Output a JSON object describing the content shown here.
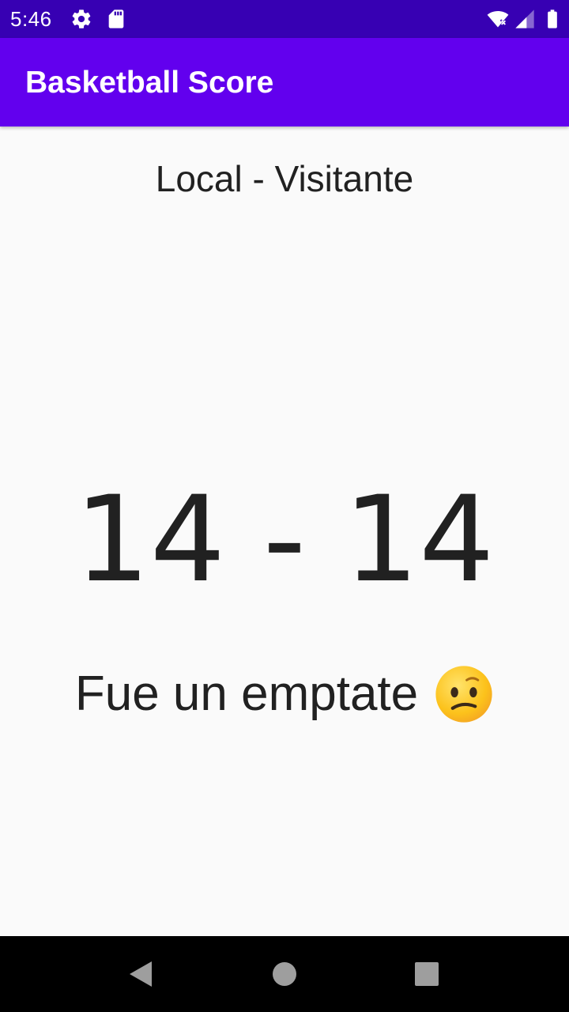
{
  "status_bar": {
    "time": "5:46",
    "icons": [
      "gear-icon",
      "sd-card-icon",
      "wifi-icon",
      "signal-icon",
      "battery-icon"
    ],
    "background": "#3700b3"
  },
  "app_bar": {
    "title": "Basketball Score",
    "background": "#6200ee"
  },
  "main": {
    "teams_label": "Local - Visitante",
    "score": "14 - 14",
    "result_text": "Fue un emptate",
    "result_emoji": "confused-face-icon"
  },
  "nav_bar": {
    "buttons": [
      "back-icon",
      "home-icon",
      "recents-icon"
    ]
  }
}
